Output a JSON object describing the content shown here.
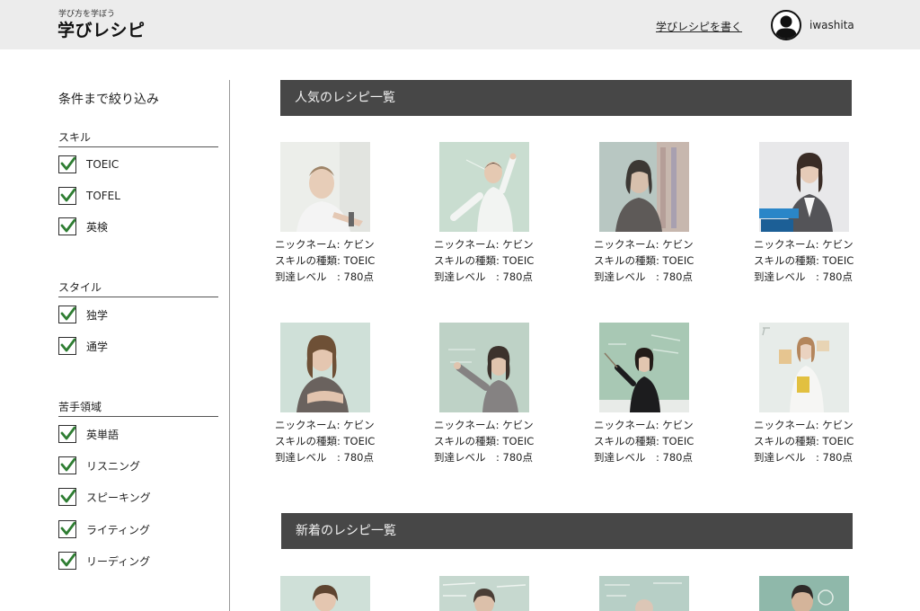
{
  "header": {
    "logo_sub": "学び方を学ぼう",
    "logo_main": "学びレシピ",
    "write_link": "学びレシピを書く",
    "username": "iwashita"
  },
  "sidebar": {
    "title": "条件まで絞り込み",
    "groups": [
      {
        "title": "スキル",
        "items": [
          {
            "label": "TOEIC",
            "checked": true
          },
          {
            "label": "TOFEL",
            "checked": true
          },
          {
            "label": "英検",
            "checked": true
          }
        ]
      },
      {
        "title": "スタイル",
        "items": [
          {
            "label": "独学",
            "checked": true
          },
          {
            "label": "通学",
            "checked": true
          }
        ]
      },
      {
        "title": "苦手領域",
        "items": [
          {
            "label": "英単語",
            "checked": true
          },
          {
            "label": "リスニング",
            "checked": true
          },
          {
            "label": "スピーキング",
            "checked": true
          },
          {
            "label": "ライティング",
            "checked": true
          },
          {
            "label": "リーディング",
            "checked": true
          }
        ]
      }
    ]
  },
  "sections": {
    "popular_title": "人気のレシピ一覧",
    "new_title": "新着のレシピ一覧"
  },
  "popular_cards": [
    {
      "nickname": "ニックネーム: ケビン",
      "skill": "スキルの種類: TOEIC",
      "level": "到達レベル　: 780点"
    },
    {
      "nickname": "ニックネーム: ケビン",
      "skill": "スキルの種類: TOEIC",
      "level": "到達レベル　: 780点"
    },
    {
      "nickname": "ニックネーム: ケビン",
      "skill": "スキルの種類: TOEIC",
      "level": "到達レベル　: 780点"
    },
    {
      "nickname": "ニックネーム: ケビン",
      "skill": "スキルの種類: TOEIC",
      "level": "到達レベル　: 780点"
    },
    {
      "nickname": "ニックネーム: ケビン",
      "skill": "スキルの種類: TOEIC",
      "level": "到達レベル　: 780点"
    },
    {
      "nickname": "ニックネーム: ケビン",
      "skill": "スキルの種類: TOEIC",
      "level": "到達レベル　: 780点"
    },
    {
      "nickname": "ニックネーム: ケビン",
      "skill": "スキルの種類: TOEIC",
      "level": "到達レベル　: 780点"
    },
    {
      "nickname": "ニックネーム: ケビン",
      "skill": "スキルの種類: TOEIC",
      "level": "到達レベル　: 780点"
    }
  ],
  "colors": {
    "header_bg": "#ececec",
    "section_bar": "#474747",
    "section_text": "#f2f2f2"
  },
  "icons": {
    "avatar": "user-silhouette-icon",
    "checkbox": "checkmark-icon"
  }
}
